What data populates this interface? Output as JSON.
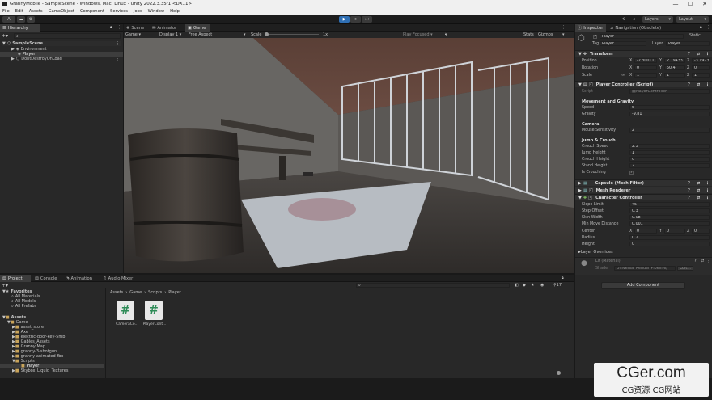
{
  "window": {
    "title": "GrannyMobile - SampleScene - Windows, Mac, Linux - Unity 2022.3.35f1 <DX11>",
    "minimize": "—",
    "maximize": "☐",
    "close": "✕"
  },
  "menu": [
    "File",
    "Edit",
    "Assets",
    "GameObject",
    "Component",
    "Services",
    "Jobs",
    "Window",
    "Help"
  ],
  "toolbar": {
    "account": "A",
    "play_glyph": "▶",
    "pause_glyph": "⏸",
    "step_glyph": "⏭",
    "layers": "Layers",
    "layout": "Layout",
    "search_glyph": "⌕",
    "history_glyph": "⟲"
  },
  "hierarchy": {
    "tab": "Hierarchy",
    "add": "+",
    "search_arrow": "▾",
    "items": [
      {
        "label": "SampleScene",
        "arrow": "▼",
        "glyph": "⬡",
        "kebab": "⋮"
      },
      {
        "label": "Environment",
        "arrow": "▶",
        "glyph": "◈"
      },
      {
        "label": "Player",
        "arrow": "",
        "glyph": "◈"
      },
      {
        "label": "DontDestroyOnLoad",
        "arrow": "▶",
        "glyph": "⬡",
        "kebab": "⋮"
      }
    ]
  },
  "scene_tabs": [
    {
      "label": "Scene",
      "glyph": "#"
    },
    {
      "label": "Animator",
      "glyph": "⛁"
    },
    {
      "label": "Game",
      "glyph": "▣"
    }
  ],
  "game_bar": {
    "view": "Game",
    "display": "Display 1",
    "aspect": "Free Aspect",
    "scale_label": "Scale",
    "scale_value": "1x",
    "play_mode": "Play Focused",
    "stats": "Stats",
    "gizmos": "Gizmos"
  },
  "project": {
    "tabs": [
      {
        "label": "Project",
        "glyph": "▤"
      },
      {
        "label": "Console",
        "glyph": "▤"
      },
      {
        "label": "Animation",
        "glyph": "◔"
      },
      {
        "label": "Audio Mixer",
        "glyph": "♫"
      }
    ],
    "add": "+",
    "count": "17",
    "favorites": {
      "label": "Favorites",
      "items": [
        "All Materials",
        "All Models",
        "All Prefabs"
      ]
    },
    "assets": {
      "label": "Assets",
      "game": "Game",
      "folders": [
        "asset_store",
        "Axe",
        "electric-door-key-5mb",
        "Gables_Assets",
        "Granny Map",
        "granny-3-shotgun",
        "granny-animated-fbx"
      ],
      "scripts": "Scripts",
      "player": "Player",
      "cut": "Skybox_Liquid_Textures"
    },
    "breadcrumb": [
      "Assets",
      "Game",
      "Scripts",
      "Player"
    ],
    "files": [
      {
        "name": "CameraCo...",
        "icon": "#"
      },
      {
        "name": "PlayerCont...",
        "icon": "#"
      }
    ]
  },
  "inspector": {
    "tabs": [
      {
        "label": "Inspector",
        "glyph": "ⓘ"
      },
      {
        "label": "Navigation (Obsolete)",
        "glyph": "⊿"
      }
    ],
    "object_name": "Player",
    "static": "Static",
    "tag_label": "Tag",
    "tag": "Player",
    "layer_label": "Layer",
    "layer": "Player",
    "transform": {
      "title": "Transform",
      "rows": [
        {
          "label": "Position",
          "x": "-2.30011",
          "y": "2.194331",
          "z": "-3.1923"
        },
        {
          "label": "Rotation",
          "x": "0",
          "y": "50.4",
          "z": "0"
        },
        {
          "label": "Scale",
          "x": "1",
          "y": "1",
          "z": "1"
        }
      ]
    },
    "player_controller": {
      "title": "Player Controller (Script)",
      "script_label": "Script",
      "script": "PlayerController",
      "movement": {
        "title": "Movement and Gravity",
        "rows": [
          {
            "label": "Speed",
            "value": "5"
          },
          {
            "label": "Gravity",
            "value": "-9.81"
          }
        ]
      },
      "camera": {
        "title": "Camera",
        "rows": [
          {
            "label": "Mouse Sensitivity",
            "value": "2"
          }
        ]
      },
      "jump": {
        "title": "Jump & Crouch",
        "rows": [
          {
            "label": "Crouch Speed",
            "value": "2.5"
          },
          {
            "label": "Jump Height",
            "value": "1"
          },
          {
            "label": "Crouch Height",
            "value": "0"
          },
          {
            "label": "Stand Height",
            "value": "2"
          },
          {
            "label": "Is Crouching",
            "value": "✓"
          }
        ]
      }
    },
    "mesh_filter": "Capsule (Mesh Filter)",
    "mesh_renderer": "Mesh Renderer",
    "character_controller": {
      "title": "Character Controller",
      "rows": [
        {
          "label": "Slope Limit",
          "value": "45"
        },
        {
          "label": "Step Offset",
          "value": "0.3"
        },
        {
          "label": "Skin Width",
          "value": "0.08"
        },
        {
          "label": "Min Move Distance",
          "value": "0.001"
        }
      ],
      "center": {
        "label": "Center",
        "x": "0",
        "y": "0",
        "z": "0"
      },
      "radius": {
        "label": "Radius",
        "value": "0.2"
      },
      "height": {
        "label": "Height",
        "value": "0"
      }
    },
    "layer_overrides": "Layer Overrides",
    "material": {
      "name": "Lit (Material)",
      "shader_label": "Shader",
      "shader": "Universal Render Pipeline/",
      "edit": "Edit..."
    },
    "add_component": "Add Component"
  },
  "watermark": {
    "site": "CGer.com",
    "sub": "CG资源 CG网站"
  },
  "colors": {
    "play_active": "#2f6fb4",
    "panel": "#282828",
    "inspector_bg": "#282828"
  }
}
